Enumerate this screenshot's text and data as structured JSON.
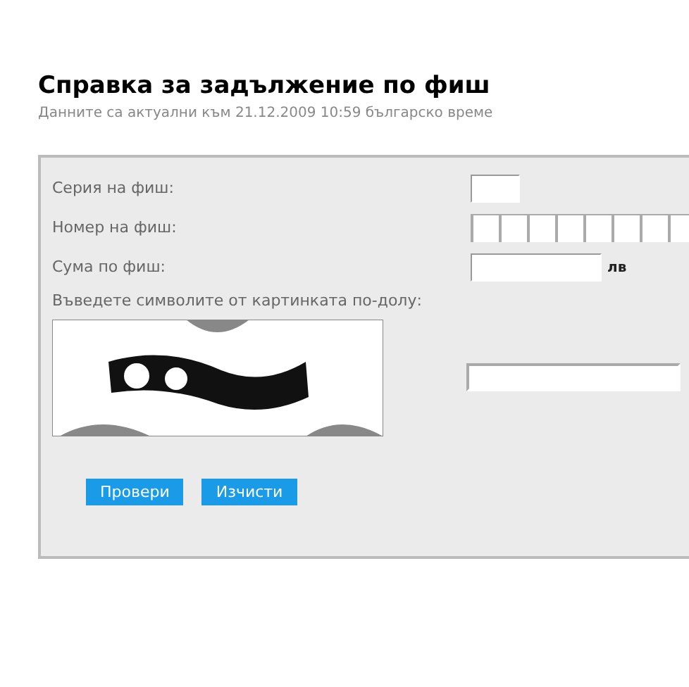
{
  "title": "Справка за задължение по фиш",
  "subtitle": "Данните са актуални към 21.12.2009 10:59 българско време",
  "fields": [
    {
      "label": "Серия на фиш:",
      "kind": "short"
    },
    {
      "label": "Номер на фиш:",
      "kind": "cells"
    },
    {
      "label": "Сума по фиш:",
      "kind": "amount",
      "unit": "лв"
    }
  ],
  "captcha": {
    "label": "Въведете символите от картинката по-долу:"
  },
  "buttons": [
    "Провери",
    "Изчисти"
  ]
}
